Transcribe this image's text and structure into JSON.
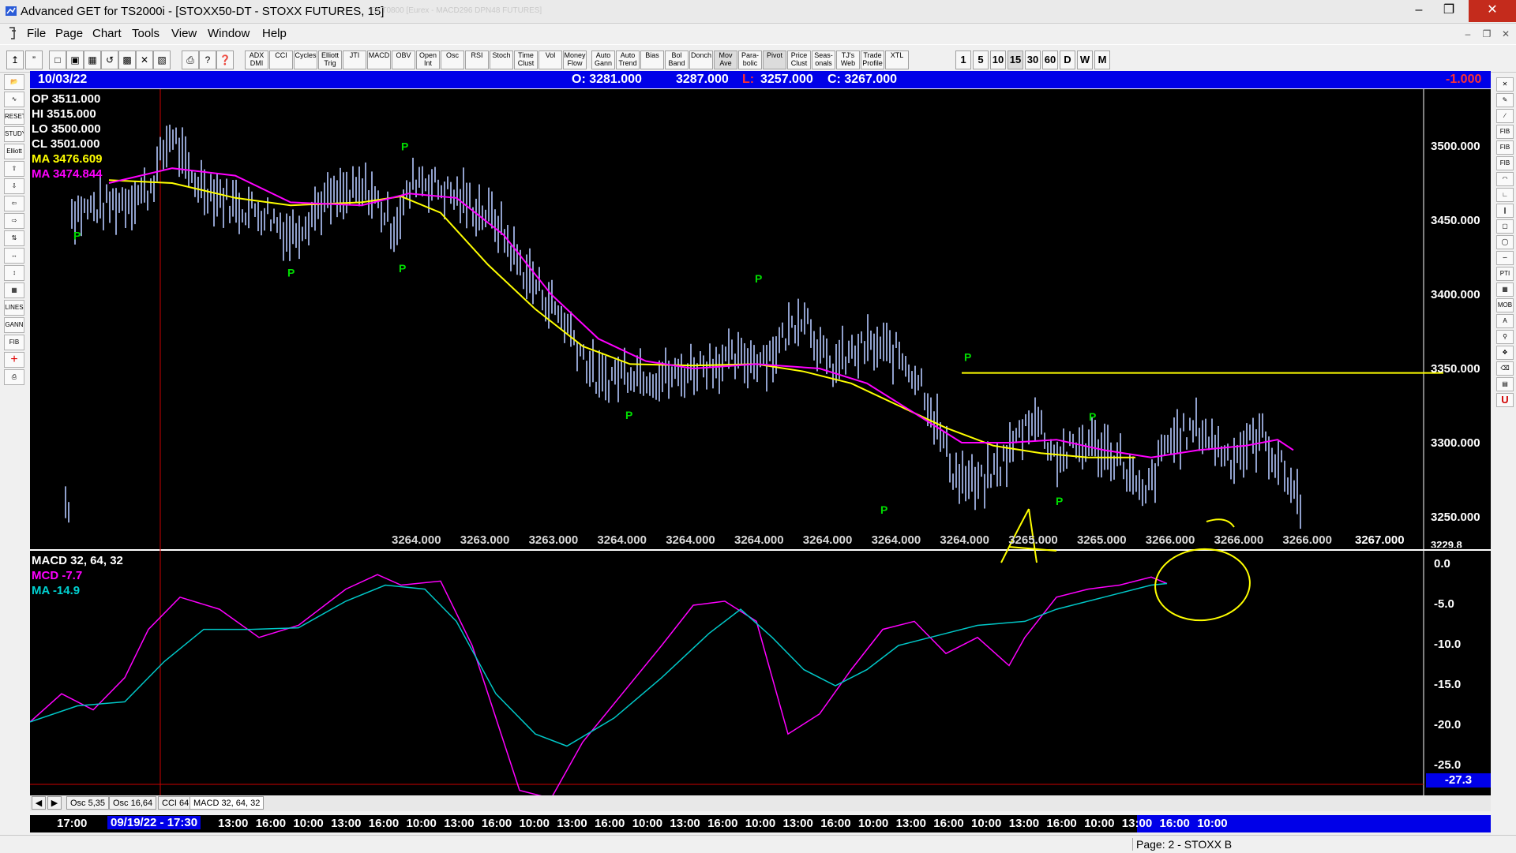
{
  "window": {
    "title": "Advanced GET for TS2000i - [STOXX50-DT - STOXX FUTURES, 15]",
    "ghost_text": "EXT0800 [Eurex - MACD296 DPN48 FUTURES]"
  },
  "menu": [
    "File",
    "Page",
    "Chart",
    "Tools",
    "View",
    "Window",
    "Help"
  ],
  "toolbar": {
    "indicators": [
      "ADX DMI",
      "CCI",
      "Cycles",
      "Elliott Trig",
      "JTI",
      "MACD",
      "OBV",
      "Open Int",
      "Osc",
      "RSI",
      "Stoch",
      "Time Clust",
      "Vol",
      "Money Flow",
      "Auto Gann",
      "Auto Trend",
      "Bias",
      "Bol Band",
      "Donch",
      "Mov Ave",
      "Para-bolic",
      "Pivot",
      "Price Clust",
      "Seas-onals",
      "TJ's Web",
      "Trade Profile",
      "XTL"
    ],
    "periods": [
      "1",
      "5",
      "10",
      "15",
      "30",
      "60",
      "D",
      "W",
      "M"
    ]
  },
  "databar": {
    "date": "10/03/22",
    "open": "O: 3281.000",
    "high": "3287.000",
    "low_label": "L:",
    "low": "3257.000",
    "close": "C: 3267.000",
    "change": "-1.000"
  },
  "price_panel": {
    "legend": [
      {
        "text": "OP  3511.000",
        "color": "#ffffff"
      },
      {
        "text": "HI   3515.000",
        "color": "#ffffff"
      },
      {
        "text": "LO  3500.000",
        "color": "#ffffff"
      },
      {
        "text": "CL  3501.000",
        "color": "#ffffff"
      },
      {
        "text": "MA  3476.609",
        "color": "#ffff00"
      },
      {
        "text": "MA  3474.844",
        "color": "#ff00ff"
      }
    ],
    "y_ticks": [
      "3500.000",
      "3450.000",
      "3400.000",
      "3350.000",
      "3300.000",
      "3250.000"
    ],
    "price_readouts": [
      "3264.000",
      "3263.000",
      "3263.000",
      "3264.000",
      "3264.000",
      "3264.000",
      "3264.000",
      "3264.000",
      "3264.000",
      "3265.000",
      "3265.000",
      "3266.000",
      "3266.000",
      "3266.000"
    ],
    "last_readout": "3267.000",
    "cut_readout": "3229.8",
    "pivot_marker": "P",
    "resistance_level": 3347
  },
  "macd_panel": {
    "title": "MACD 32, 64, 32",
    "mcd": "MCD -7.7",
    "ma": "MA   -14.9",
    "y_ticks": [
      "0.0",
      "-5.0",
      "-10.0",
      "-15.0",
      "-20.0",
      "-25.0"
    ],
    "current_value": "-27.3"
  },
  "tabs": [
    "Osc 5,35",
    "Osc 16,64",
    "CCI 64",
    "MACD 32, 64, 32"
  ],
  "timeline": {
    "first": "17:00",
    "cursor": "09/19/22 - 17:30",
    "labels": [
      "13:00",
      "16:00",
      "10:00",
      "13:00",
      "16:00",
      "10:00",
      "13:00",
      "16:00",
      "10:00",
      "13:00",
      "16:00",
      "10:00",
      "13:00",
      "16:00",
      "10:00",
      "13:00",
      "16:00",
      "10:00",
      "13:00",
      "16:00",
      "10:00",
      "13:00",
      "16:00",
      "10:00",
      "13:00",
      "16:00",
      "10:00"
    ]
  },
  "status": "Page: 2 - STOXX B",
  "colors": {
    "databar": "#0000e8",
    "ma_yellow": "#ffff00",
    "ma_magenta": "#ff00ff",
    "macd_ma": "#00c8c8",
    "bars": "#b4c8ff",
    "pivot": "#00dd00"
  }
}
